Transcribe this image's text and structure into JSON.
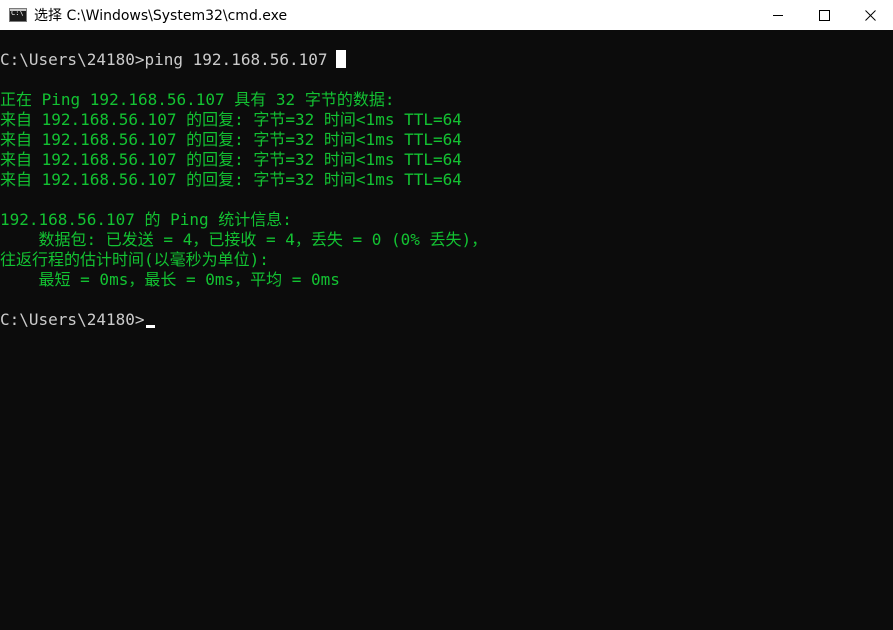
{
  "window": {
    "title": "选择 C:\\Windows\\System32\\cmd.exe",
    "icon": "cmd-icon",
    "controls": [
      "minimize-icon",
      "maximize-icon",
      "close-icon"
    ]
  },
  "colors": {
    "background": "#0c0c0c",
    "output_text": "#13c232",
    "prompt_text": "#cccccc",
    "titlebar": "#ffffff"
  },
  "console": {
    "prompt1": "C:\\Users\\24180>ping 192.168.56.107",
    "ping_header": "正在 Ping 192.168.56.107 具有 32 字节的数据:",
    "replies": [
      "来自 192.168.56.107 的回复: 字节=32 时间<1ms TTL=64",
      "来自 192.168.56.107 的回复: 字节=32 时间<1ms TTL=64",
      "来自 192.168.56.107 的回复: 字节=32 时间<1ms TTL=64",
      "来自 192.168.56.107 的回复: 字节=32 时间<1ms TTL=64"
    ],
    "stats_header": "192.168.56.107 的 Ping 统计信息:",
    "packets": "    数据包: 已发送 = 4，已接收 = 4，丢失 = 0 (0% 丢失)，",
    "rtt_header": "往返行程的估计时间(以毫秒为单位):",
    "rtt_values": "    最短 = 0ms，最长 = 0ms，平均 = 0ms",
    "prompt2": "C:\\Users\\24180>"
  }
}
